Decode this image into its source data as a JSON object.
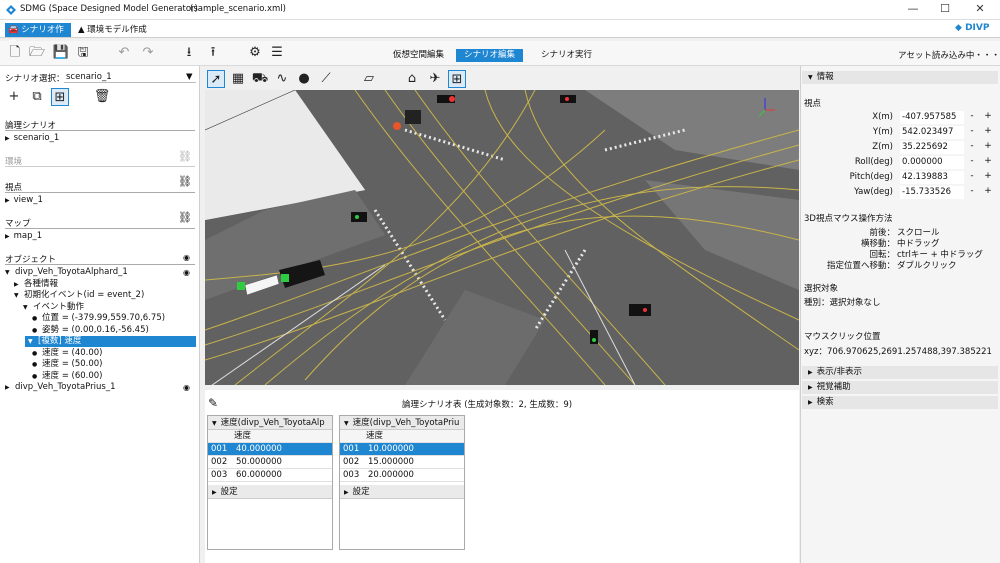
{
  "window": {
    "title": "SDMG (Space Designed Model Generator)",
    "file": "(sample_scenario.xml)",
    "min": "—",
    "max": "☐",
    "close": "✕"
  },
  "tabs": [
    {
      "label": "シナリオ作成"
    },
    {
      "label": "環境モデル作成"
    }
  ],
  "brand": "DIVP",
  "modes": [
    {
      "label": "仮想空間編集"
    },
    {
      "label": "シナリオ編集"
    },
    {
      "label": "シナリオ実行"
    }
  ],
  "asset_load": "アセット読み込み中・・・",
  "left": {
    "scenario_select_label": "シナリオ選択：",
    "scenario_value": "scenario_1",
    "logical_header": "論理シナリオ",
    "logical_item": "scenario_1",
    "env_header": "環境",
    "view_header": "視点",
    "view_item": "view_1",
    "map_header": "マップ",
    "map_item": "map_1",
    "object_header": "オブジェクト",
    "tree": [
      {
        "text": "divp_Veh_ToyotaAlphard_1",
        "level": 0,
        "arrow": "▼",
        "eye": true
      },
      {
        "text": "各種情報",
        "level": 1,
        "arrow": "▶"
      },
      {
        "text": "初期化イベント(id = event_2)",
        "level": 1,
        "arrow": "▼"
      },
      {
        "text": "イベント動作",
        "level": 2,
        "arrow": "▼"
      },
      {
        "text": "位置 = (-379.99,559.70,6.75)",
        "level": 3,
        "arrow": "●"
      },
      {
        "text": "姿勢 = (0.00,0.16,-56.45)",
        "level": 3,
        "arrow": "●"
      },
      {
        "text": "[複数] 速度",
        "level": 2,
        "arrow": "▼",
        "selected": true
      },
      {
        "text": "速度 = (40.00)",
        "level": 3,
        "arrow": "●"
      },
      {
        "text": "速度 = (50.00)",
        "level": 3,
        "arrow": "●"
      },
      {
        "text": "速度 = (60.00)",
        "level": 3,
        "arrow": "●"
      },
      {
        "text": "divp_Veh_ToyotaPrius_1",
        "level": 0,
        "arrow": "▶",
        "eye": true
      }
    ]
  },
  "bottom": {
    "title": "論理シナリオ表 (生成対象数：2, 生成数：9)",
    "tables": [
      {
        "header": "速度(divp_Veh_ToyotaAlp",
        "col": "速度",
        "rows": [
          {
            "id": "001",
            "val": "40.000000",
            "sel": true
          },
          {
            "id": "002",
            "val": "50.000000"
          },
          {
            "id": "003",
            "val": "60.000000"
          }
        ],
        "settings": "設定"
      },
      {
        "header": "速度(divp_Veh_ToyotaPriu",
        "col": "速度",
        "rows": [
          {
            "id": "001",
            "val": "10.000000",
            "sel": true
          },
          {
            "id": "002",
            "val": "15.000000"
          },
          {
            "id": "003",
            "val": "20.000000"
          }
        ],
        "settings": "設定"
      }
    ]
  },
  "right": {
    "info": "情報",
    "viewpoint": "視点",
    "params": [
      {
        "label": "X(m)",
        "value": "-407.957585"
      },
      {
        "label": "Y(m)",
        "value": "542.023497"
      },
      {
        "label": "Z(m)",
        "value": "35.225692"
      },
      {
        "label": "Roll(deg)",
        "value": "0.000000"
      },
      {
        "label": "Pitch(deg)",
        "value": "42.139883"
      },
      {
        "label": "Yaw(deg)",
        "value": "-15.733526"
      }
    ],
    "mouse_header": "3D視点マウス操作方法",
    "mouse_ops": [
      {
        "k": "前後：",
        "v": "スクロール"
      },
      {
        "k": "横移動：",
        "v": "中ドラッグ"
      },
      {
        "k": "回転：",
        "v": "ctrlキー + 中ドラッグ"
      },
      {
        "k": "指定位置へ移動：",
        "v": "ダブルクリック"
      }
    ],
    "select_header": "選択対象",
    "select_value": "種別：選択対象なし",
    "click_header": "マウスクリック位置",
    "click_value": "xyz：706.970625,2691.257488,397.385221",
    "sections": [
      {
        "label": "表示/非表示"
      },
      {
        "label": "視覚補助"
      },
      {
        "label": "検索"
      }
    ]
  },
  "colors": {
    "accent": "#1f86d1",
    "road": "#5d5d5d",
    "lane": "#c9b44a"
  }
}
